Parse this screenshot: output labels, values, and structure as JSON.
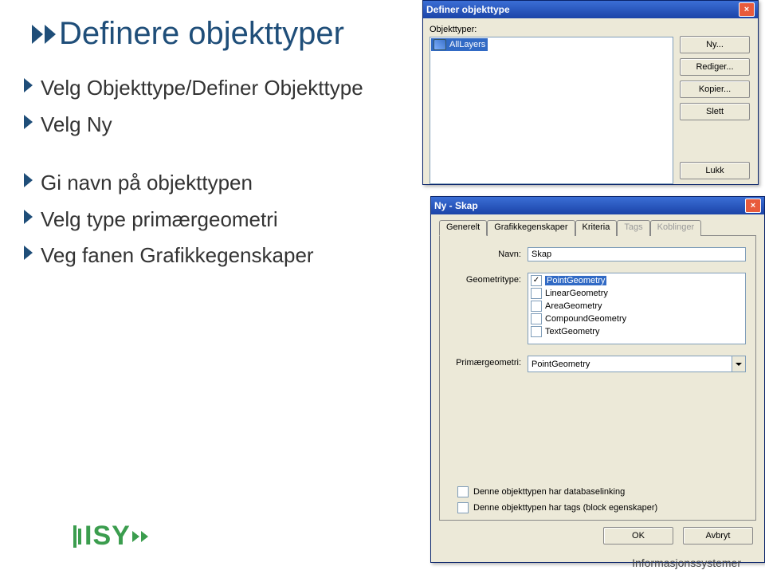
{
  "slide": {
    "title": "Definere objekttyper",
    "bullets": [
      "Velg Objekttype/Definer Objekttype",
      "Velg Ny",
      "Gi navn på objekttypen",
      "Velg type primærgeometri",
      "Veg fanen Grafikkegenskaper"
    ]
  },
  "dlg1": {
    "title": "Definer objekttype",
    "list_label": "Objekttyper:",
    "list_item": "AllLayers",
    "buttons": {
      "ny": "Ny...",
      "rediger": "Rediger...",
      "kopier": "Kopier...",
      "slett": "Slett",
      "lukk": "Lukk"
    }
  },
  "dlg2": {
    "title": "Ny - Skap",
    "tabs": {
      "generelt": "Generelt",
      "grafikk": "Grafikkegenskaper",
      "kriteria": "Kriteria",
      "tags": "Tags",
      "koblinger": "Koblinger"
    },
    "name_label": "Navn:",
    "name_value": "Skap",
    "geo_label": "Geometritype:",
    "geo_items": {
      "point": "PointGeometry",
      "linear": "LinearGeometry",
      "area": "AreaGeometry",
      "compound": "CompoundGeometry",
      "text": "TextGeometry"
    },
    "primary_label": "Primærgeometri:",
    "primary_value": "PointGeometry",
    "check_db": "Denne objekttypen har databaselinking",
    "check_tags": "Denne objekttypen har tags (block egenskaper)",
    "ok": "OK",
    "cancel": "Avbryt"
  },
  "footer": {
    "brand": "ISY",
    "note": "Informasjonssystemer"
  }
}
